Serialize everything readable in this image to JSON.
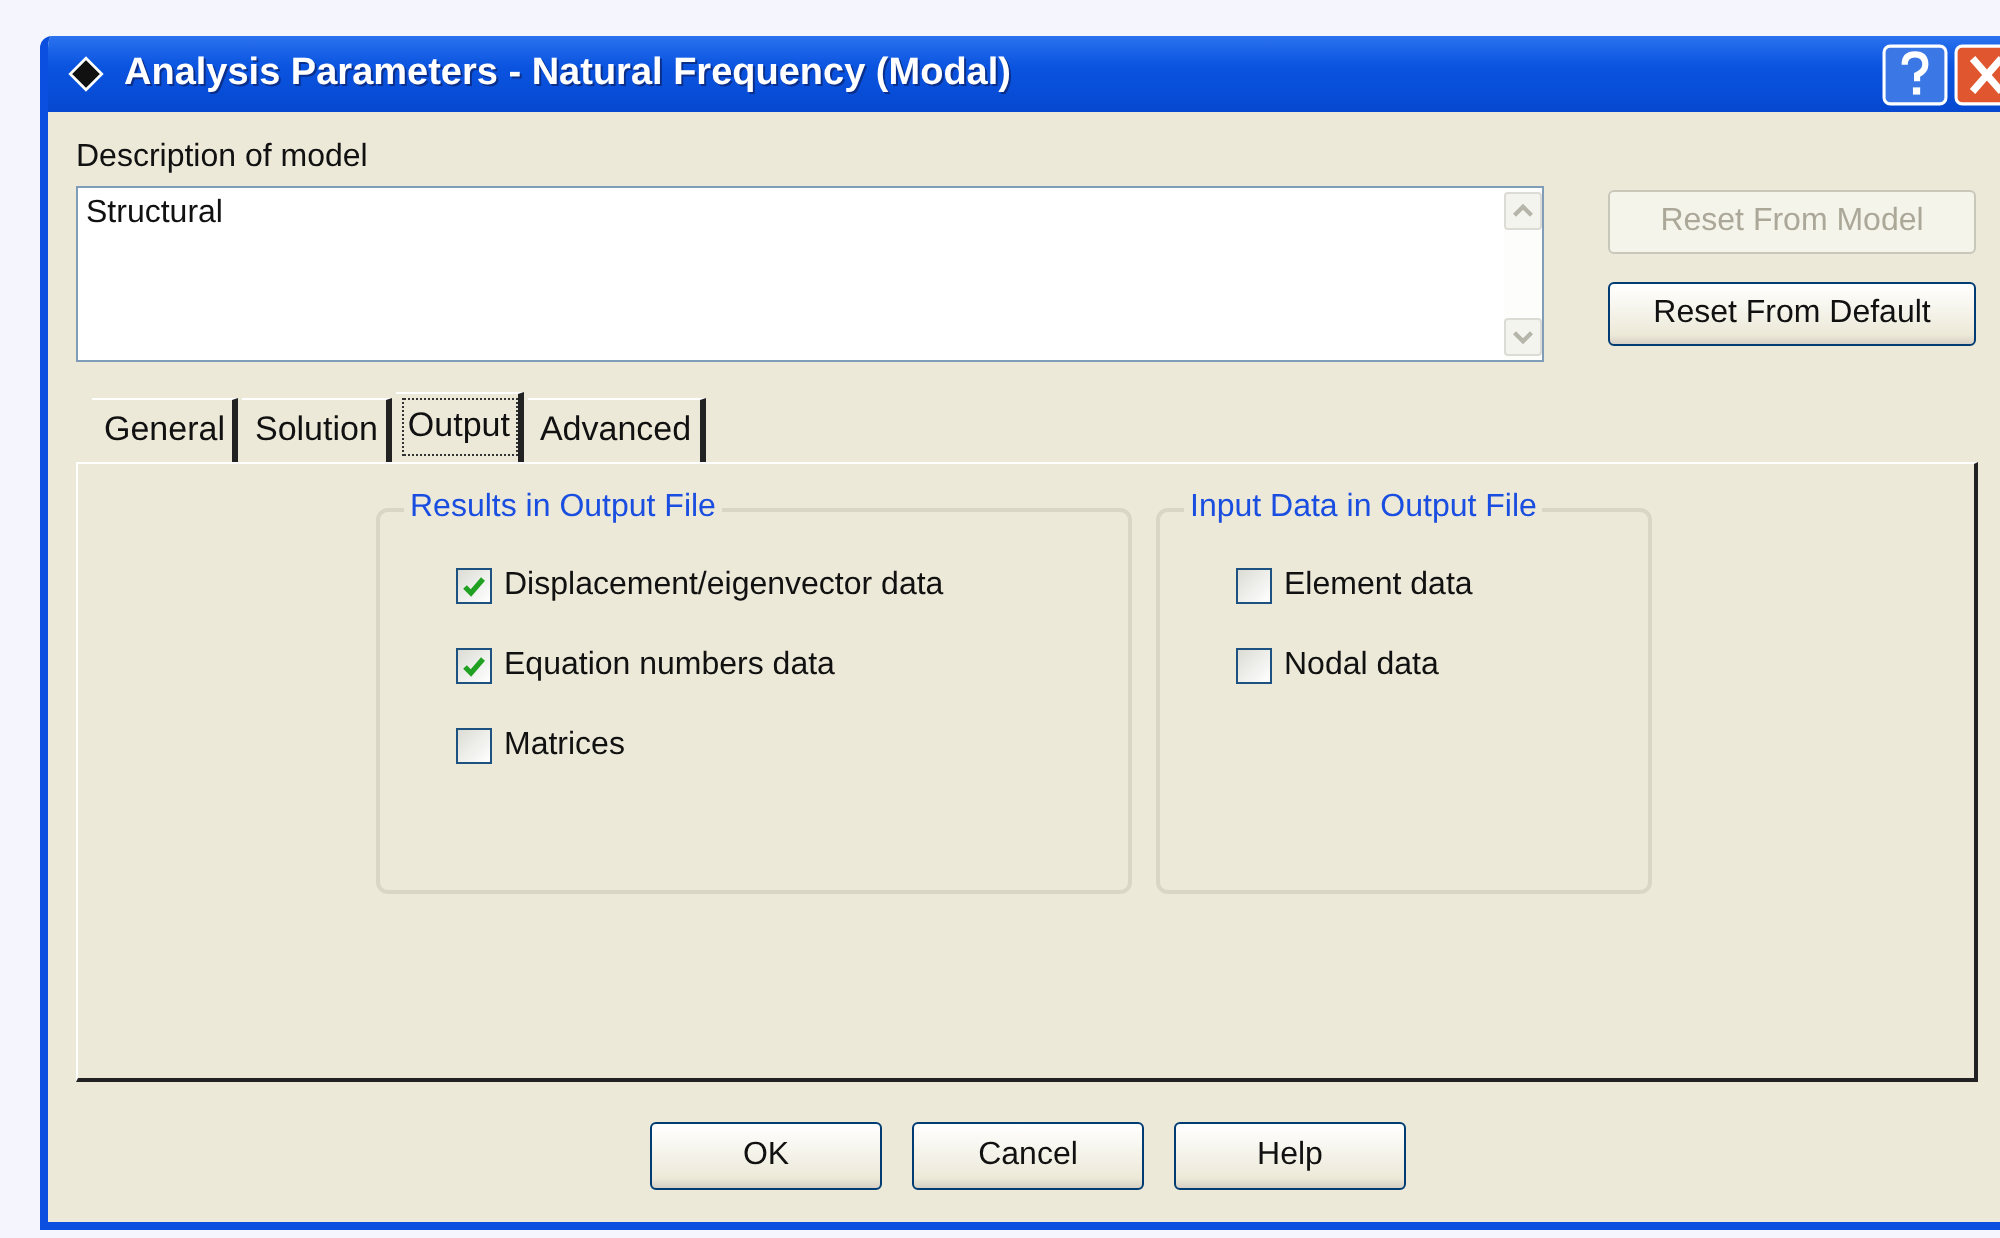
{
  "window": {
    "title": "Analysis Parameters - Natural Frequency (Modal)"
  },
  "description": {
    "label": "Description of model",
    "value": "Structural"
  },
  "side_buttons": [
    {
      "label": "Reset From Model",
      "disabled": true
    },
    {
      "label": "Reset From Default",
      "disabled": false
    }
  ],
  "tabs": [
    {
      "label": "General",
      "selected": false
    },
    {
      "label": "Solution",
      "selected": false
    },
    {
      "label": "Output",
      "selected": true
    },
    {
      "label": "Advanced",
      "selected": false
    }
  ],
  "groups": [
    {
      "title": "Results in Output File",
      "options": [
        {
          "label": "Displacement/eigenvector data",
          "checked": true
        },
        {
          "label": "Equation numbers data",
          "checked": true
        },
        {
          "label": "Matrices",
          "checked": false
        }
      ]
    },
    {
      "title": "Input Data in Output File",
      "options": [
        {
          "label": "Element data",
          "checked": false
        },
        {
          "label": "Nodal data",
          "checked": false
        }
      ]
    }
  ],
  "buttons": [
    "OK",
    "Cancel",
    "Help"
  ]
}
